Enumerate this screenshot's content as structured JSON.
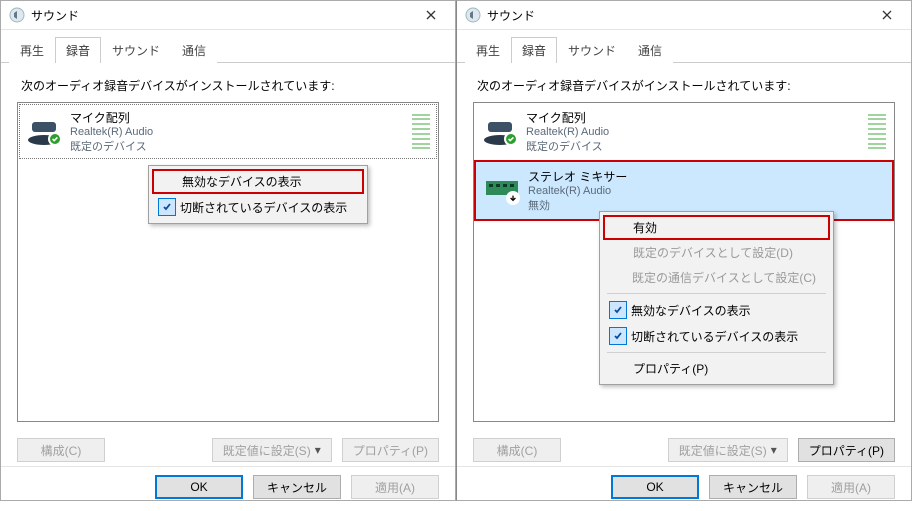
{
  "window": {
    "title": "サウンド",
    "close": "×"
  },
  "tabs": {
    "playback": "再生",
    "recording": "録音",
    "sound": "サウンド",
    "comm": "通信"
  },
  "instruction": "次のオーディオ録音デバイスがインストールされています:",
  "devices": {
    "mic": {
      "name": "マイク配列",
      "driver": "Realtek(R) Audio",
      "status": "既定のデバイス"
    },
    "mixer": {
      "name": "ステレオ ミキサー",
      "driver": "Realtek(R) Audio",
      "status": "無効"
    }
  },
  "ctx_left": {
    "show_disabled": "無効なデバイスの表示",
    "show_disconnected": "切断されているデバイスの表示"
  },
  "ctx_right": {
    "enable": "有効",
    "set_default": "既定のデバイスとして設定(D)",
    "set_default_comm": "既定の通信デバイスとして設定(C)",
    "show_disabled": "無効なデバイスの表示",
    "show_disconnected": "切断されているデバイスの表示",
    "properties": "プロパティ(P)"
  },
  "buttons": {
    "configure": "構成(C)",
    "set_default": "既定値に設定(S)",
    "properties": "プロパティ(P)",
    "ok": "OK",
    "cancel": "キャンセル",
    "apply": "適用(A)"
  }
}
